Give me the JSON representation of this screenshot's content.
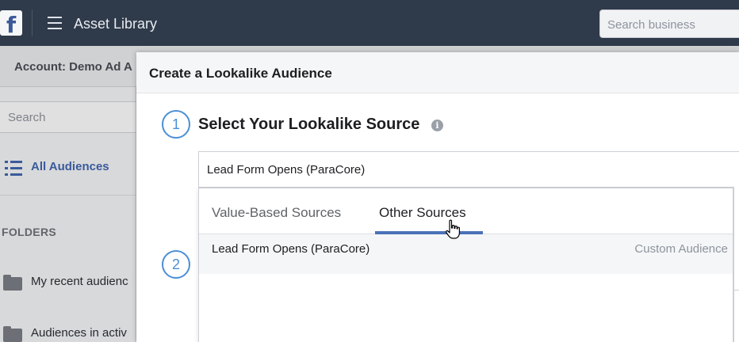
{
  "topbar": {
    "logo_letter": "f",
    "title": "Asset Library",
    "search_placeholder": "Search business"
  },
  "account_bar": {
    "label": "Account: Demo Ad A"
  },
  "sidebar": {
    "search_placeholder": "Search",
    "all_audiences": "All Audiences",
    "folders_heading": "FOLDERS",
    "folders": [
      {
        "label": "My recent audienc"
      },
      {
        "label": "Audiences in activ"
      }
    ]
  },
  "modal": {
    "title": "Create a Lookalike Audience",
    "step1": {
      "number": "1",
      "title": "Select Your Lookalike Source",
      "info_icon": "info-icon",
      "selected_source": "Lead Form Opens (ParaCore)"
    },
    "step2": {
      "number": "2"
    },
    "dropdown": {
      "tabs": [
        {
          "label": "Value-Based Sources",
          "active": false
        },
        {
          "label": "Other Sources",
          "active": true
        }
      ],
      "options": [
        {
          "name": "Lead Form Opens (ParaCore)",
          "type": "Custom Audience"
        }
      ]
    }
  },
  "colors": {
    "topbar": "#2f3a4a",
    "accent": "#4267b2",
    "step_circle": "#4b8fd6",
    "tab_underline": "#4a72b8"
  }
}
